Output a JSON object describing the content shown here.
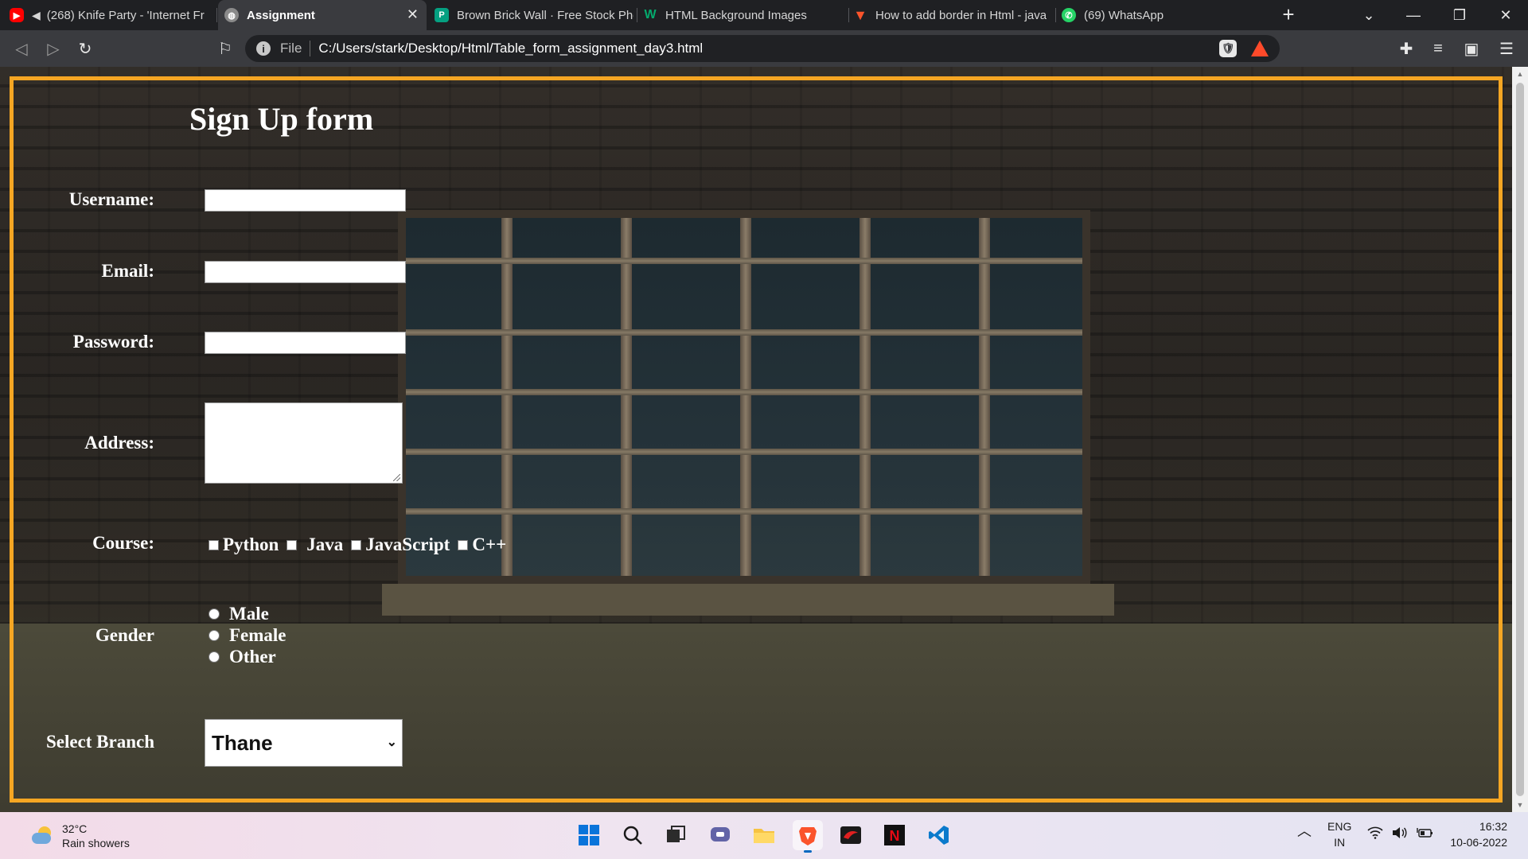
{
  "browser": {
    "tabs": [
      {
        "title": "(268) Knife Party - 'Internet Fr",
        "icon": "youtube-icon",
        "active": false
      },
      {
        "title": "Assignment",
        "icon": "globe-icon",
        "active": true
      },
      {
        "title": "Brown Brick Wall · Free Stock Pho",
        "icon": "pexels-icon",
        "active": false
      },
      {
        "title": "HTML Background Images",
        "icon": "w3schools-icon",
        "active": false
      },
      {
        "title": "How to add border in Html - java",
        "icon": "brave-search-icon",
        "active": false
      },
      {
        "title": "(69) WhatsApp",
        "icon": "whatsapp-icon",
        "active": false
      }
    ],
    "url_scheme_label": "File",
    "url": "C:/Users/stark/Desktop/Html/Table_form_assignment_day3.html"
  },
  "form": {
    "title": "Sign Up form",
    "username_label": "Username:",
    "username_value": "",
    "email_label": "Email:",
    "email_value": "",
    "password_label": "Password:",
    "password_value": "",
    "address_label": "Address:",
    "address_value": "",
    "course_label": "Course:",
    "courses": [
      "Python",
      "Java",
      "JavaScript",
      "C++"
    ],
    "gender_label": "Gender",
    "genders": [
      "Male",
      "Female",
      "Other"
    ],
    "branch_label": "Select Branch",
    "branch_value": "Thane",
    "border_color": "#f5a623"
  },
  "taskbar": {
    "weather_temp": "32°C",
    "weather_desc": "Rain showers",
    "lang_line1": "ENG",
    "lang_line2": "IN",
    "time": "16:32",
    "date": "10-06-2022"
  }
}
